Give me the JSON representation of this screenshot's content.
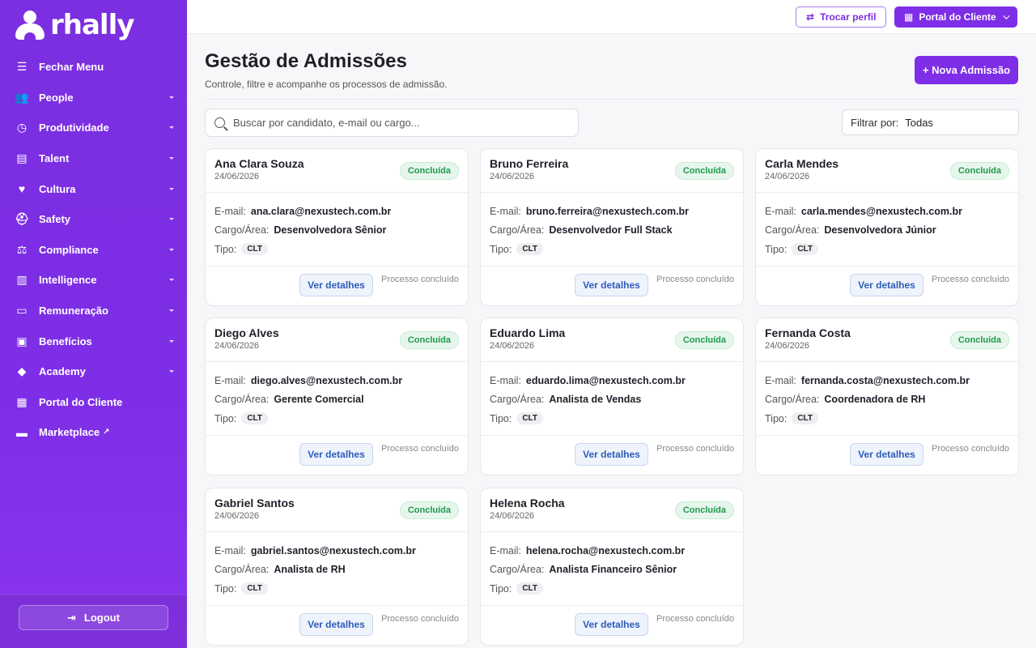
{
  "brand": {
    "name": "rhally"
  },
  "sidebar": {
    "items": [
      {
        "label": "Fechar Menu",
        "icon": "menu-icon",
        "caret": false
      },
      {
        "label": "People",
        "icon": "users-icon",
        "caret": true
      },
      {
        "label": "Produtividade",
        "icon": "clock-icon",
        "caret": true
      },
      {
        "label": "Talent",
        "icon": "list-icon",
        "caret": true
      },
      {
        "label": "Cultura",
        "icon": "heart-icon",
        "caret": true
      },
      {
        "label": "Safety",
        "icon": "hardhat-icon",
        "caret": true
      },
      {
        "label": "Compliance",
        "icon": "scale-icon",
        "caret": true
      },
      {
        "label": "Intelligence",
        "icon": "chart-icon",
        "caret": true
      },
      {
        "label": "Remuneração",
        "icon": "money-icon",
        "caret": true
      },
      {
        "label": "Benefícios",
        "icon": "gift-icon",
        "caret": true
      },
      {
        "label": "Academy",
        "icon": "graduation-icon",
        "caret": true
      },
      {
        "label": "Portal do Cliente",
        "icon": "building-icon",
        "caret": false
      },
      {
        "label": "Marketplace",
        "icon": "store-icon",
        "caret": false,
        "external": "↗"
      }
    ],
    "logout_label": "Logout"
  },
  "topbar": {
    "switch_profile_label": "Trocar perfil",
    "portal_label": "Portal do Cliente"
  },
  "header": {
    "title": "Gestão de Admissões",
    "subtitle": "Controle, filtre e acompanhe os processos de admissão.",
    "new_button_label": "+ Nova Admissão"
  },
  "search": {
    "placeholder": "Buscar por candidato, e-mail ou cargo...",
    "value": ""
  },
  "filter": {
    "label": "Filtrar por:",
    "value": "Todas"
  },
  "labels": {
    "email": "E-mail:",
    "role": "Cargo/Área:",
    "type": "Tipo:",
    "details_button": "Ver detalhes",
    "process_done": "Processo concluído"
  },
  "status_colors": {
    "concluida_bg": "#e7f6ec",
    "concluida_text": "#1f9a4d",
    "accent": "#7e2ee6"
  },
  "cards": [
    {
      "name": "Ana Clara Souza",
      "date": "24/06/2026",
      "status": "Concluída",
      "email": "ana.clara@nexustech.com.br",
      "role": "Desenvolvedora Sênior",
      "type": "CLT"
    },
    {
      "name": "Bruno Ferreira",
      "date": "24/06/2026",
      "status": "Concluída",
      "email": "bruno.ferreira@nexustech.com.br",
      "role": "Desenvolvedor Full Stack",
      "type": "CLT"
    },
    {
      "name": "Carla Mendes",
      "date": "24/06/2026",
      "status": "Concluída",
      "email": "carla.mendes@nexustech.com.br",
      "role": "Desenvolvedora Júnior",
      "type": "CLT"
    },
    {
      "name": "Diego Alves",
      "date": "24/06/2026",
      "status": "Concluída",
      "email": "diego.alves@nexustech.com.br",
      "role": "Gerente Comercial",
      "type": "CLT"
    },
    {
      "name": "Eduardo Lima",
      "date": "24/06/2026",
      "status": "Concluída",
      "email": "eduardo.lima@nexustech.com.br",
      "role": "Analista de Vendas",
      "type": "CLT"
    },
    {
      "name": "Fernanda Costa",
      "date": "24/06/2026",
      "status": "Concluída",
      "email": "fernanda.costa@nexustech.com.br",
      "role": "Coordenadora de RH",
      "type": "CLT"
    },
    {
      "name": "Gabriel Santos",
      "date": "24/06/2026",
      "status": "Concluída",
      "email": "gabriel.santos@nexustech.com.br",
      "role": "Analista de RH",
      "type": "CLT"
    },
    {
      "name": "Helena Rocha",
      "date": "24/06/2026",
      "status": "Concluída",
      "email": "helena.rocha@nexustech.com.br",
      "role": "Analista Financeiro Sênior",
      "type": "CLT"
    }
  ]
}
